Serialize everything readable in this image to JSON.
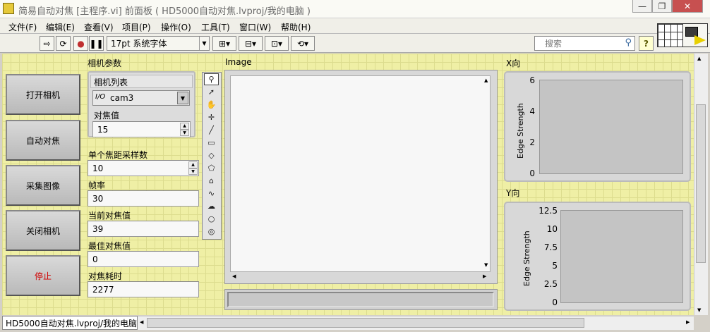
{
  "window": {
    "title": "简易自动对焦 [主程序.vi] 前面板 ( HD5000自动对焦.lvproj/我的电脑 )",
    "minimize": "—",
    "restore": "❐",
    "close": "✕"
  },
  "menu": [
    "文件(F)",
    "编辑(E)",
    "查看(V)",
    "项目(P)",
    "操作(O)",
    "工具(T)",
    "窗口(W)",
    "帮助(H)"
  ],
  "toolbar": {
    "font": "17pt 系统字体",
    "search_placeholder": "搜索",
    "help": "?"
  },
  "buttons": {
    "open": "打开相机",
    "autofocus": "自动对焦",
    "capture": "采集图像",
    "close": "关闭相机",
    "stop": "停止"
  },
  "colors": {
    "stop": "#d00000",
    "panel": "#efefa5"
  },
  "camera": {
    "section_label": "相机参数",
    "list_label": "相机列表",
    "list_prefix": "I/O",
    "camera_value": "cam3",
    "focus_label": "对焦值",
    "focus_value": "15"
  },
  "fields": [
    {
      "label": "单个焦距采样数",
      "value": "10"
    },
    {
      "label": "帧率",
      "value": "30"
    },
    {
      "label": "当前对焦值",
      "value": "39"
    },
    {
      "label": "最佳对焦值",
      "value": "0"
    },
    {
      "label": "对焦耗时",
      "value": "2277"
    }
  ],
  "image": {
    "label": "Image"
  },
  "graphs": {
    "x": {
      "label": "X向",
      "ylabel": "Edge Strength",
      "ticks": [
        "6",
        "4",
        "2",
        "0"
      ]
    },
    "y": {
      "label": "Y向",
      "ylabel": "Edge Strength",
      "ticks": [
        "12.5",
        "10",
        "7.5",
        "5",
        "2.5",
        "0"
      ]
    }
  },
  "status": {
    "path": "HD5000自动对焦.lvproj/我的电脑"
  }
}
